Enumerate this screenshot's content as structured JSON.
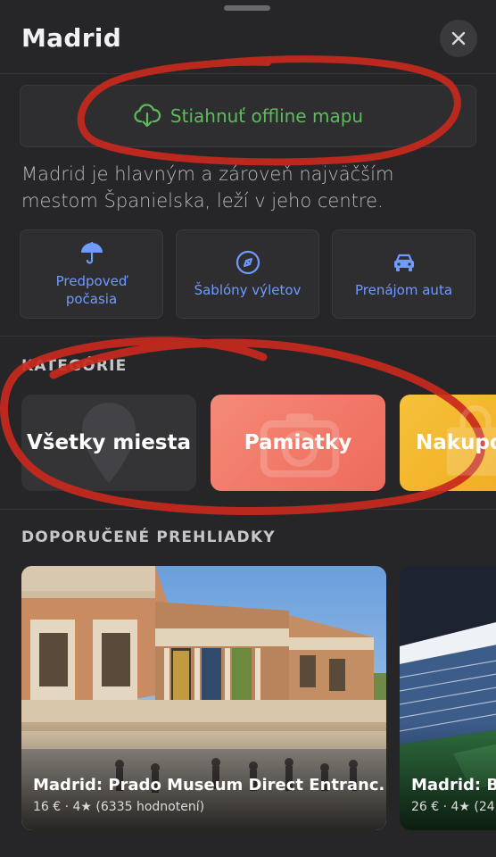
{
  "header": {
    "title": "Madrid"
  },
  "offline": {
    "label": "Stiahnuť offline mapu"
  },
  "description": "Madrid je hlavným a zároveň najväčším mestom Španielska, leží v jeho centre.",
  "quick_actions": [
    {
      "icon": "umbrella-icon",
      "line1": "Predpoveď",
      "line2": "počasia"
    },
    {
      "icon": "compass-icon",
      "line1": "Šablóny výletov",
      "line2": ""
    },
    {
      "icon": "car-icon",
      "line1": "Prenájom auta",
      "line2": ""
    }
  ],
  "categories_section": {
    "label": "KATEGÓRIE",
    "items": [
      {
        "label": "Všetky miesta",
        "color": "#3a3a3d"
      },
      {
        "label": "Pamiatky",
        "color": "#f37a6a"
      },
      {
        "label": "Nakupovanie",
        "color": "#f2b321"
      }
    ]
  },
  "tours_section": {
    "label": "DOPORUČENÉ PREHLIADKY",
    "items": [
      {
        "title": "Madrid: Prado Museum Direct Entranc...",
        "meta": "16 € · 4★ (6335 hodnotení)"
      },
      {
        "title": "Madrid: Be",
        "meta": "26 € · 4★ (24"
      }
    ]
  },
  "colors": {
    "accent_green": "#5dbb5a",
    "accent_blue": "#6f9bff",
    "annotation_red": "#c8281c"
  }
}
